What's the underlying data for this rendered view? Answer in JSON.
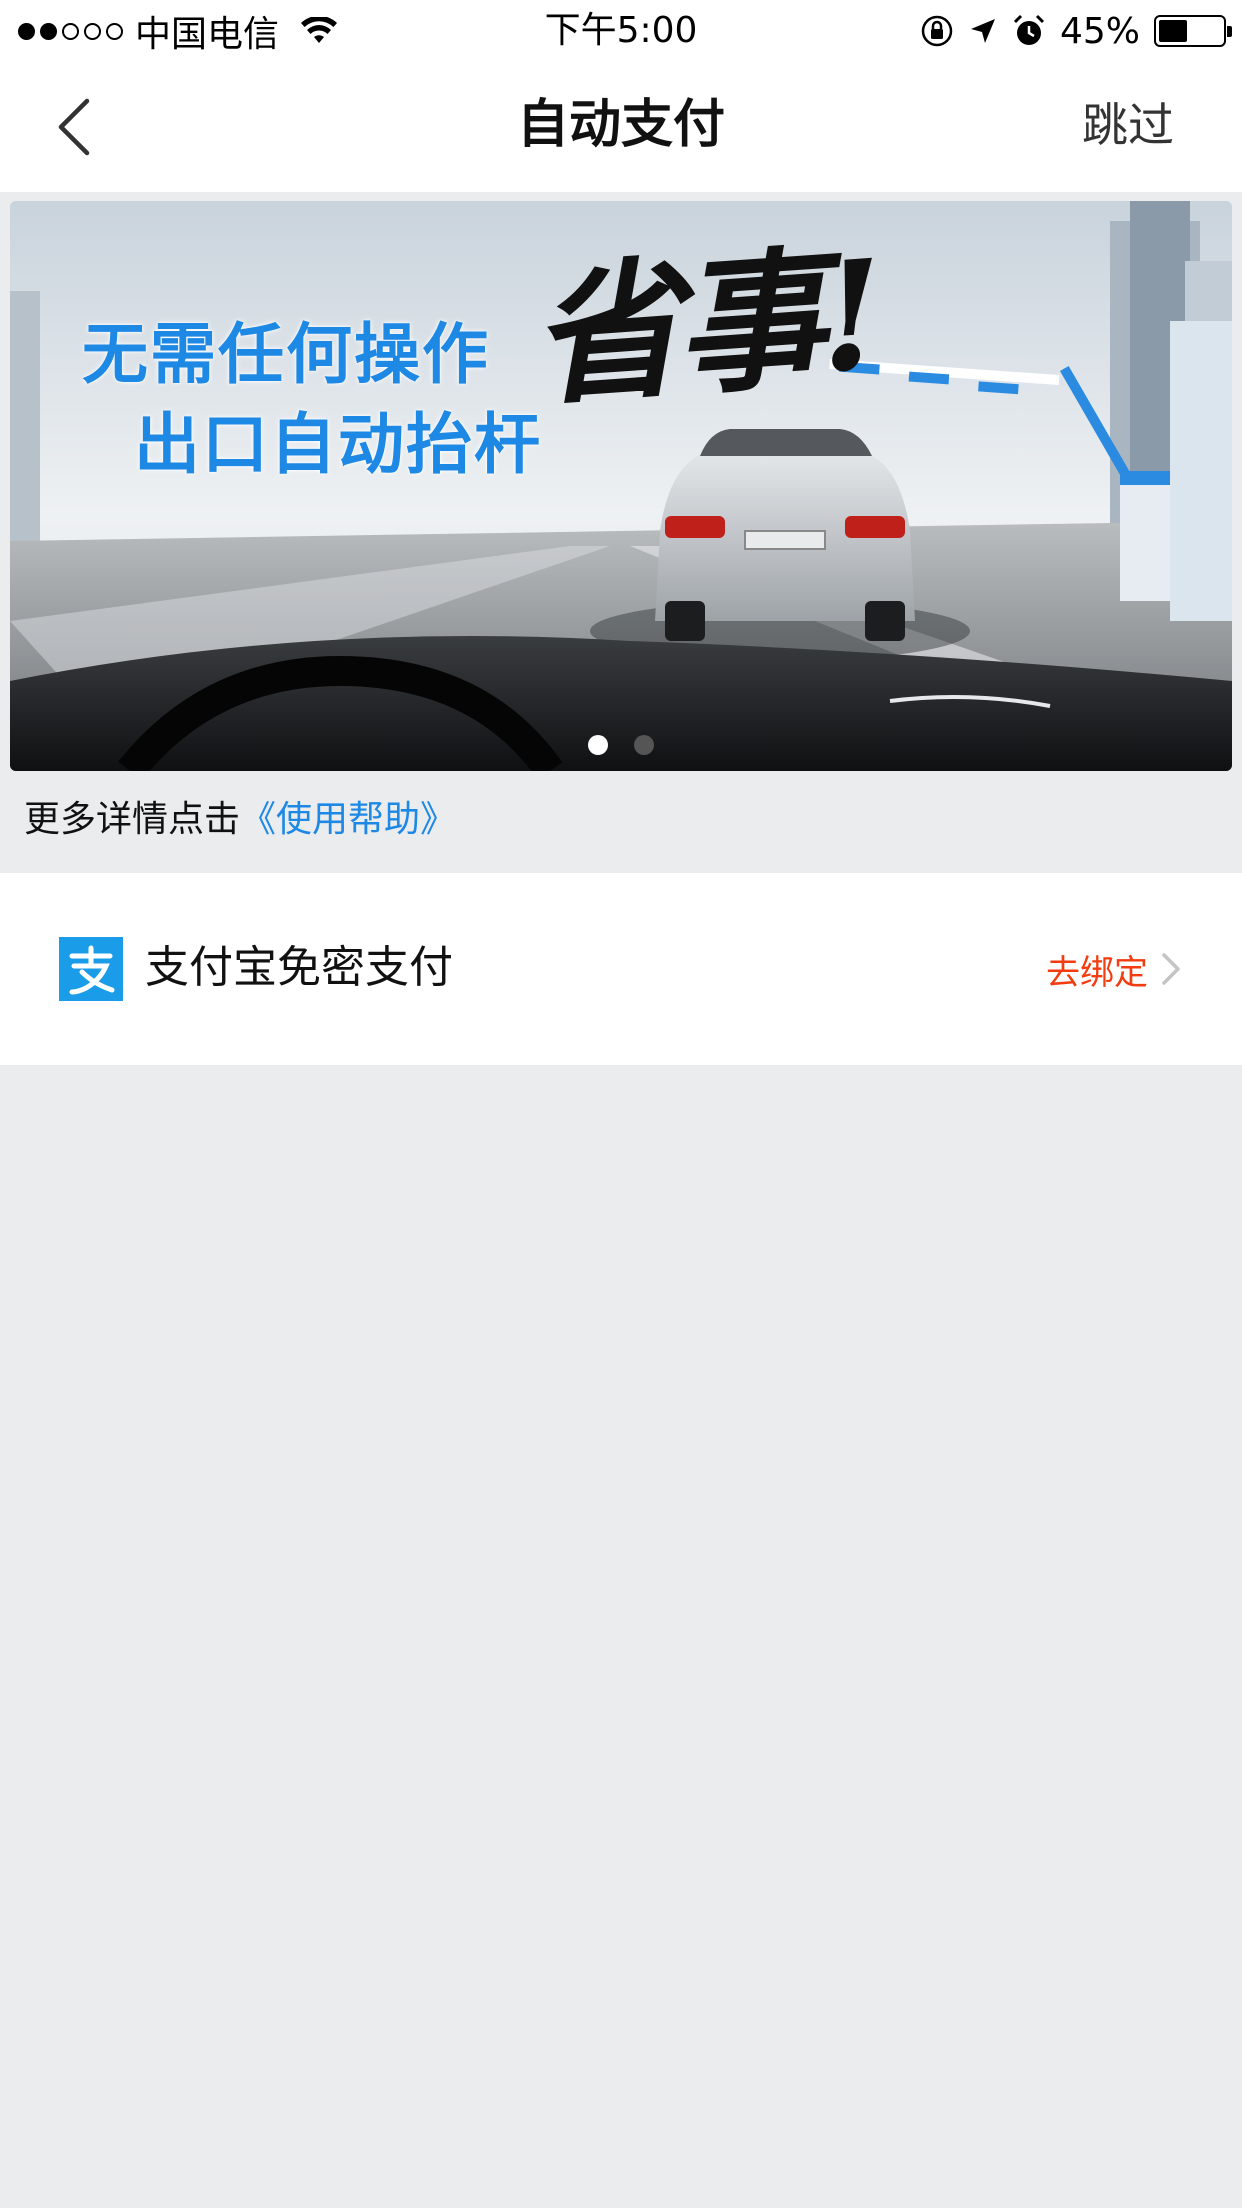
{
  "status_bar": {
    "carrier": "中国电信",
    "time": "下午5:00",
    "battery_percent": "45%",
    "battery_level": 0.45,
    "signal_bars_filled": 2,
    "signal_bars_total": 5,
    "icons": [
      "wifi-icon",
      "orientation-lock-icon",
      "location-arrow-icon",
      "alarm-icon",
      "battery-icon"
    ]
  },
  "nav": {
    "title": "自动支付",
    "back_icon": "chevron-left-icon",
    "skip_label": "跳过"
  },
  "banner": {
    "line1": "无需任何操作",
    "line2": "出口自动抬杆",
    "slogan": "省事!",
    "pager_count": 2,
    "pager_active_index": 0
  },
  "help": {
    "prefix": "更多详情点击",
    "link": "《使用帮助》"
  },
  "payment": {
    "icon": "alipay-icon",
    "label": "支付宝免密支付",
    "action_label": "去绑定",
    "action_icon": "chevron-right-icon"
  },
  "colors": {
    "accent_blue": "#1e88e5",
    "action_red": "#f23d10",
    "alipay_blue": "#1a9ce8",
    "page_background": "#ebecee"
  }
}
